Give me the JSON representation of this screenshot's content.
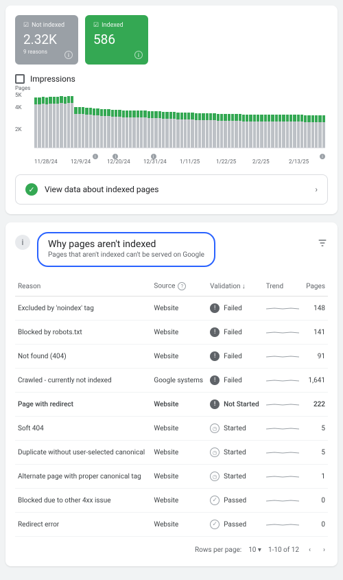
{
  "stats": {
    "notIndexed": {
      "label": "Not indexed",
      "value": "2.32K",
      "sub": "9 reasons"
    },
    "indexed": {
      "label": "Indexed",
      "value": "586"
    }
  },
  "impressions_label": "Impressions",
  "chart_data": {
    "type": "bar",
    "ylabel": "Pages",
    "ylim": [
      0,
      5000
    ],
    "yticks": [
      "5K",
      "4K",
      "2K"
    ],
    "categories": [
      "11/28/24",
      "12/9/24",
      "12/20/24",
      "12/31/24",
      "1/11/25",
      "1/22/25",
      "2/2/25",
      "2/13/25"
    ],
    "series": [
      {
        "name": "Not indexed",
        "color": "#bdc1c6",
        "values": [
          4300,
          4300,
          4350,
          4300,
          4350,
          4350,
          4350,
          4400,
          4350,
          4400,
          4400,
          3500,
          3500,
          3450,
          3400,
          3400,
          3350,
          3350,
          3300,
          3300,
          3300,
          3250,
          3250,
          3250,
          3200,
          3200,
          3200,
          3200,
          3150,
          3150,
          3150,
          3100,
          3100,
          3100,
          3100,
          3050,
          3050,
          3050,
          3050,
          3000,
          3000,
          3000,
          3000,
          3000,
          2950,
          2950,
          2950,
          2950,
          2950,
          2950,
          2900,
          2900,
          2900,
          2900,
          2900,
          2900,
          2900,
          2850,
          2850,
          2850,
          2850,
          2850,
          2850,
          2850,
          2850,
          2800,
          2800,
          2800,
          2800,
          2800,
          2800,
          2800,
          2800,
          2800,
          2750,
          2750,
          2750,
          2750,
          2750,
          2750
        ]
      },
      {
        "name": "Indexed",
        "color": "#34a853",
        "values": [
          600,
          600,
          600,
          600,
          600,
          600,
          600,
          600,
          600,
          600,
          600,
          580,
          580,
          580,
          580,
          580,
          580,
          580,
          580,
          580,
          580,
          580,
          580,
          580,
          580,
          580,
          580,
          580,
          580,
          580,
          580,
          580,
          580,
          580,
          580,
          580,
          580,
          580,
          580,
          580,
          580,
          580,
          580,
          580,
          580,
          580,
          580,
          580,
          580,
          580,
          580,
          580,
          580,
          580,
          580,
          580,
          580,
          580,
          580,
          580,
          580,
          580,
          580,
          580,
          580,
          580,
          580,
          580,
          580,
          580,
          580,
          580,
          580,
          580,
          580,
          580,
          580,
          580,
          580,
          580
        ]
      }
    ]
  },
  "view_link": "View data about indexed pages",
  "reasons": {
    "title": "Why pages aren't indexed",
    "subtitle": "Pages that aren't indexed can't be served on Google",
    "columns": {
      "reason": "Reason",
      "source": "Source",
      "validation": "Validation",
      "trend": "Trend",
      "pages": "Pages"
    },
    "rows": [
      {
        "reason": "Excluded by 'noindex' tag",
        "source": "Website",
        "validation": "Failed",
        "icon": "fail",
        "pages": "148",
        "bold": false
      },
      {
        "reason": "Blocked by robots.txt",
        "source": "Website",
        "validation": "Failed",
        "icon": "fail",
        "pages": "141",
        "bold": false
      },
      {
        "reason": "Not found (404)",
        "source": "Website",
        "validation": "Failed",
        "icon": "fail",
        "pages": "91",
        "bold": false
      },
      {
        "reason": "Crawled - currently not indexed",
        "source": "Google systems",
        "validation": "Failed",
        "icon": "fail",
        "pages": "1,641",
        "bold": false
      },
      {
        "reason": "Page with redirect",
        "source": "Website",
        "validation": "Not Started",
        "icon": "fail",
        "pages": "222",
        "bold": true
      },
      {
        "reason": "Soft 404",
        "source": "Website",
        "validation": "Started",
        "icon": "clock",
        "pages": "5",
        "bold": false
      },
      {
        "reason": "Duplicate without user-selected canonical",
        "source": "Website",
        "validation": "Started",
        "icon": "clock",
        "pages": "5",
        "bold": false
      },
      {
        "reason": "Alternate page with proper canonical tag",
        "source": "Website",
        "validation": "Started",
        "icon": "clock",
        "pages": "1",
        "bold": false
      },
      {
        "reason": "Blocked due to other 4xx issue",
        "source": "Website",
        "validation": "Passed",
        "icon": "pass",
        "pages": "0",
        "bold": false
      },
      {
        "reason": "Redirect error",
        "source": "Website",
        "validation": "Passed",
        "icon": "pass",
        "pages": "0",
        "bold": false
      }
    ]
  },
  "pager": {
    "rpp_label": "Rows per page:",
    "rpp": "10",
    "range": "1-10 of 12"
  }
}
